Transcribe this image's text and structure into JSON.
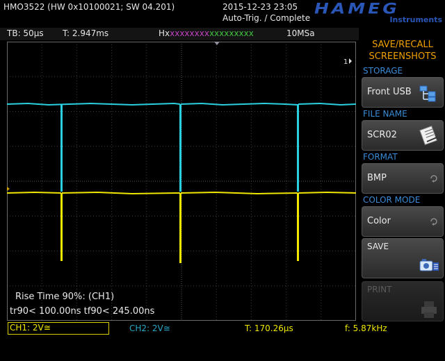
{
  "header": {
    "device_id": "HMO3522 (HW 0x10100021; SW 04.201)",
    "datetime": "2015-12-23 23:05",
    "trigger_status": "Auto-Trig. / Complete",
    "brand": "HAMEG",
    "brand_sub": "Instruments"
  },
  "infobar": {
    "timebase": "TB: 50µs",
    "trigger_pos": "T: 2.947ms",
    "hx_prefix": "Hx",
    "hx_magenta": "xxxxxxxx",
    "hx_green": "xxxxxxxxx",
    "sample_rate": "10MSa"
  },
  "measurement": {
    "title": "Rise Time 90%: (CH1)",
    "values": "tr90< 100.00ns   tf90< 245.00ns"
  },
  "statusbar": {
    "ch1": "CH1: 2V≅",
    "ch2": "CH2: 2V≅",
    "period": "T: 170.26µs",
    "frequency": "f: 5.87kHz"
  },
  "menu": {
    "title_line1": "SAVE/RECALL",
    "title_line2": "SCREENSHOTS",
    "storage_label": "STORAGE",
    "storage_value": "Front USB",
    "filename_label": "FILE NAME",
    "filename_value": "SCR02",
    "format_label": "FORMAT",
    "format_value": "BMP",
    "colormode_label": "COLOR MODE",
    "colormode_value": "Color",
    "save_label": "SAVE",
    "print_label": "PRINT"
  },
  "markers": {
    "ch1_marker": "1"
  },
  "colors": {
    "ch1": "#f0e800",
    "ch2": "#2ad0e0",
    "accent": "#f0a000",
    "section": "#3a8cd8",
    "brand": "#2a56b8"
  }
}
